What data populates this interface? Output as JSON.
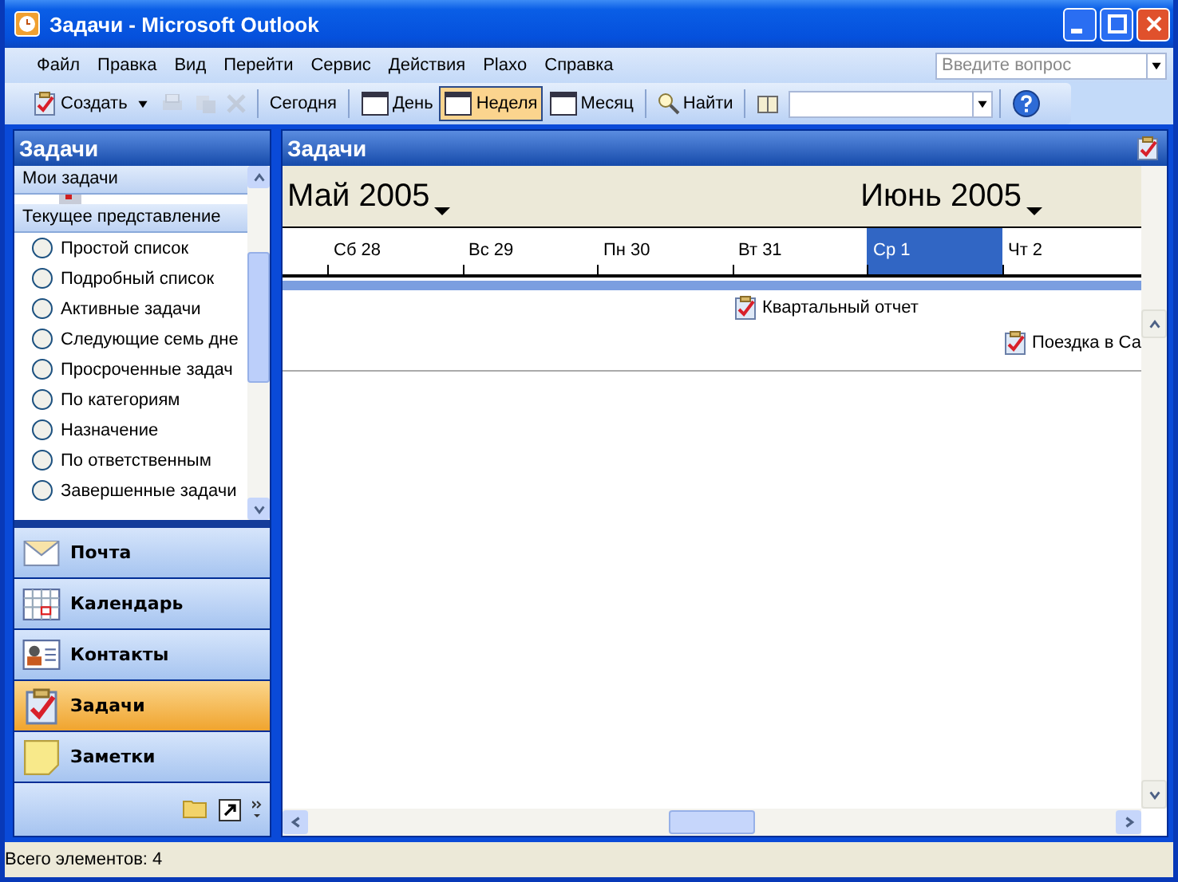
{
  "window": {
    "title": "Задачи - Microsoft Outlook"
  },
  "menu": [
    "Файл",
    "Правка",
    "Вид",
    "Перейти",
    "Сервис",
    "Действия",
    "Plaxo",
    "Справка"
  ],
  "help_search": {
    "placeholder": "Введите вопрос"
  },
  "toolbar": [
    {
      "kind": "split",
      "label": "Создать"
    },
    {
      "kind": "icon",
      "disabled": true
    },
    {
      "kind": "icon",
      "disabled": true
    },
    {
      "kind": "icon",
      "disabled": true
    },
    {
      "kind": "sep"
    },
    {
      "kind": "text",
      "label": "Сегодня"
    },
    {
      "kind": "sep"
    },
    {
      "kind": "labeled",
      "label": "День",
      "selected": false
    },
    {
      "kind": "labeled",
      "label": "Неделя",
      "selected": true
    },
    {
      "kind": "labeled",
      "label": "Месяц",
      "selected": false
    },
    {
      "kind": "sep"
    },
    {
      "kind": "labeled",
      "label": "Найти"
    },
    {
      "kind": "sep"
    },
    {
      "kind": "icon",
      "disabled": false
    },
    {
      "kind": "combo"
    },
    {
      "kind": "sep"
    },
    {
      "kind": "icon",
      "disabled": false
    }
  ],
  "sidebar": {
    "title": "Задачи",
    "my_tasks": "Мои задачи",
    "view_header": "Текущее представление",
    "views": [
      {
        "label": "Простой список",
        "selected": false
      },
      {
        "label": "Подробный список",
        "selected": false
      },
      {
        "label": "Активные задачи",
        "selected": false
      },
      {
        "label": "Следующие семь дне",
        "selected": false
      },
      {
        "label": "Просроченные задач",
        "selected": false
      },
      {
        "label": "По категориям",
        "selected": false
      },
      {
        "label": "Назначение",
        "selected": false
      },
      {
        "label": "По ответственным",
        "selected": false
      },
      {
        "label": "Завершенные задачи",
        "selected": false
      }
    ],
    "nav": [
      {
        "label": "Почта",
        "selected": false
      },
      {
        "label": "Календарь",
        "selected": false
      },
      {
        "label": "Контакты",
        "selected": false
      },
      {
        "label": "Задачи",
        "selected": true
      },
      {
        "label": "Заметки",
        "selected": false
      }
    ]
  },
  "main": {
    "title": "Задачи",
    "months": [
      {
        "label": "Май 2005"
      },
      {
        "label": "Июнь 2005"
      }
    ],
    "days": [
      {
        "label": "Сб 28",
        "selected": false
      },
      {
        "label": "Вс 29",
        "selected": false
      },
      {
        "label": "Пн 30",
        "selected": false
      },
      {
        "label": "Вт 31",
        "selected": false,
        "tasks": [
          "Квартальный отчет"
        ]
      },
      {
        "label": "Ср 1",
        "selected": true
      },
      {
        "label": "Чт 2",
        "selected": false,
        "tasks": [
          "Поездка в Са"
        ]
      }
    ]
  },
  "status_bar": {
    "text": "Всего элементов: 4"
  }
}
